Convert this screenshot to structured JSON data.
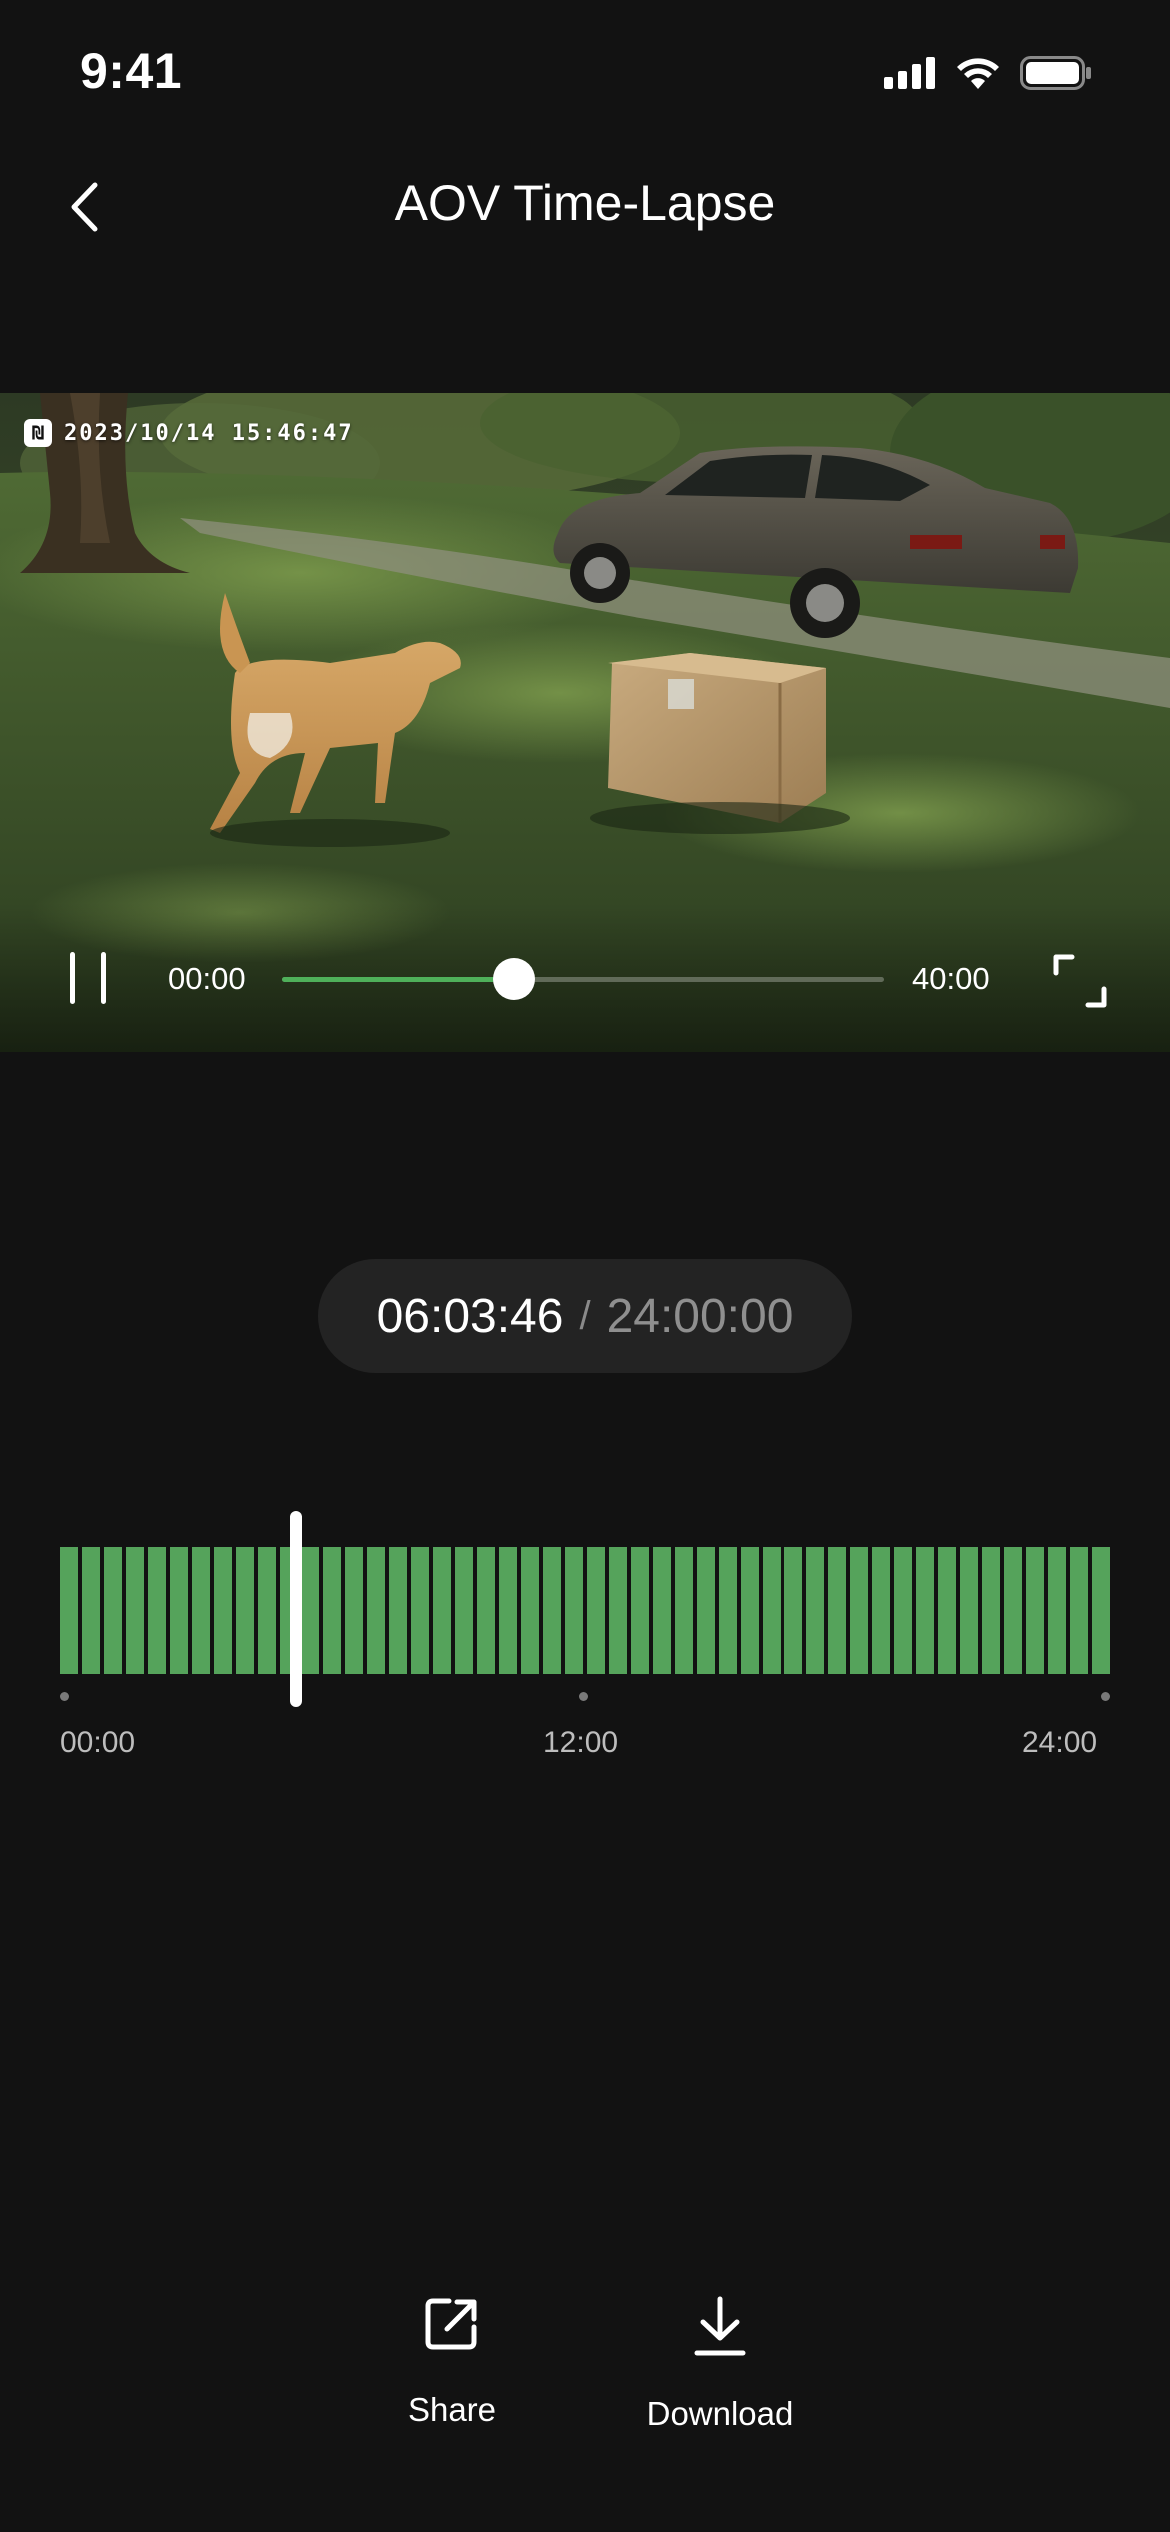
{
  "status_bar": {
    "time": "9:41",
    "icons": [
      "signal-icon",
      "wifi-icon",
      "battery-icon"
    ]
  },
  "nav": {
    "title": "AOV Time-Lapse",
    "back_icon": "chevron-left-icon"
  },
  "video": {
    "timestamp": "2023/10/14 15:46:47",
    "badge_glyph": "₪",
    "scene_description_icon": "camera-feed-image",
    "current_time": "00:00",
    "total_time": "40:00",
    "progress_fraction": 0.385,
    "accent_color": "#4fb05a"
  },
  "playback": {
    "current": "06:03:46",
    "separator": "/",
    "total": "24:00:00"
  },
  "timeline": {
    "bar_count": 48,
    "bar_color": "#55a35b",
    "playhead_fraction": 0.225,
    "labels": [
      "00:00",
      "12:00",
      "24:00"
    ]
  },
  "actions": {
    "share": {
      "label": "Share",
      "icon": "share-icon"
    },
    "download": {
      "label": "Download",
      "icon": "download-icon"
    }
  },
  "colors": {
    "background": "#121212",
    "pill": "#232323"
  }
}
